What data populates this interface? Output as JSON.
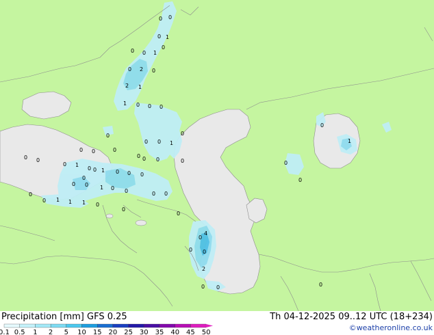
{
  "title": {
    "left": "Precipitation [mm]  GFS 0.25",
    "right": "Th 04-12-2025 09..12 UTC (18+234)"
  },
  "credit": "©weatheronline.co.uk",
  "colors": {
    "land": "#c5f5a0",
    "sea": "#e9e9e9",
    "border": "#8c8c8c",
    "precip_light": "#bfeef6",
    "precip_mid": "#8fdcef",
    "precip_heavy": "#4fc0e6"
  },
  "legend": {
    "ticks": [
      "0.1",
      "0.5",
      "1",
      "2",
      "5",
      "10",
      "15",
      "20",
      "25",
      "30",
      "35",
      "40",
      "45",
      "50"
    ],
    "colors": [
      "#e6fafe",
      "#c5f2fb",
      "#a4e9f8",
      "#7fdcf3",
      "#4cc8ee",
      "#1e9fe0",
      "#1a6fd2",
      "#1b40c2",
      "#2319a8",
      "#4a0fa5",
      "#8409ad",
      "#b80fb5",
      "#e01ec0"
    ]
  },
  "map_labels": [
    {
      "id": "l01",
      "text": "0"
    },
    {
      "id": "l02",
      "text": "0"
    },
    {
      "id": "l03",
      "text": "0"
    },
    {
      "id": "l04",
      "text": "0"
    },
    {
      "id": "l05",
      "text": "1"
    },
    {
      "id": "l06",
      "text": "0"
    },
    {
      "id": "l07",
      "text": "0"
    },
    {
      "id": "l08",
      "text": "1"
    },
    {
      "id": "l09",
      "text": "0"
    },
    {
      "id": "l10",
      "text": "2"
    },
    {
      "id": "l11",
      "text": "0"
    },
    {
      "id": "l12",
      "text": "2"
    },
    {
      "id": "l13",
      "text": "1"
    },
    {
      "id": "l14",
      "text": "1"
    },
    {
      "id": "l15",
      "text": "0"
    },
    {
      "id": "l16",
      "text": "0"
    },
    {
      "id": "l17",
      "text": "0"
    },
    {
      "id": "l18",
      "text": "0"
    },
    {
      "id": "l19",
      "text": "0"
    },
    {
      "id": "l20",
      "text": "0"
    },
    {
      "id": "l21",
      "text": "0"
    },
    {
      "id": "l22",
      "text": "0"
    },
    {
      "id": "l23",
      "text": "1"
    },
    {
      "id": "l24",
      "text": "0"
    },
    {
      "id": "l25",
      "text": "0"
    },
    {
      "id": "l26",
      "text": "0"
    },
    {
      "id": "l27",
      "text": "0"
    },
    {
      "id": "l28",
      "text": "0"
    },
    {
      "id": "l29",
      "text": "1"
    },
    {
      "id": "l30",
      "text": "1"
    },
    {
      "id": "l31",
      "text": "0"
    },
    {
      "id": "l32",
      "text": "0"
    },
    {
      "id": "l33",
      "text": "0"
    },
    {
      "id": "l34",
      "text": "0"
    },
    {
      "id": "l35",
      "text": "0"
    },
    {
      "id": "l36",
      "text": "0"
    },
    {
      "id": "l37",
      "text": "0"
    },
    {
      "id": "l38",
      "text": "1"
    },
    {
      "id": "l39",
      "text": "0"
    },
    {
      "id": "l40",
      "text": "0"
    },
    {
      "id": "l41",
      "text": "0"
    },
    {
      "id": "l42",
      "text": "0"
    },
    {
      "id": "l43",
      "text": "0"
    },
    {
      "id": "l44",
      "text": "1"
    },
    {
      "id": "l45",
      "text": "1"
    },
    {
      "id": "l46",
      "text": "1"
    },
    {
      "id": "l47",
      "text": "0"
    },
    {
      "id": "l48",
      "text": "0"
    },
    {
      "id": "l49",
      "text": "0"
    },
    {
      "id": "l50",
      "text": "0"
    },
    {
      "id": "l51",
      "text": "0"
    },
    {
      "id": "l52",
      "text": "0"
    },
    {
      "id": "l53",
      "text": "0"
    },
    {
      "id": "l54",
      "text": "0"
    },
    {
      "id": "l55",
      "text": "4"
    },
    {
      "id": "l56",
      "text": "0"
    },
    {
      "id": "l57",
      "text": "0"
    },
    {
      "id": "l58",
      "text": "0"
    },
    {
      "id": "l59",
      "text": "2"
    },
    {
      "id": "l60",
      "text": "0"
    },
    {
      "id": "l61",
      "text": "0"
    },
    {
      "id": "l62",
      "text": "0"
    },
    {
      "id": "l63",
      "text": "0"
    },
    {
      "id": "l64",
      "text": "1"
    },
    {
      "id": "l65",
      "text": "0"
    },
    {
      "id": "l66",
      "text": "0"
    },
    {
      "id": "l67",
      "text": "0"
    }
  ]
}
